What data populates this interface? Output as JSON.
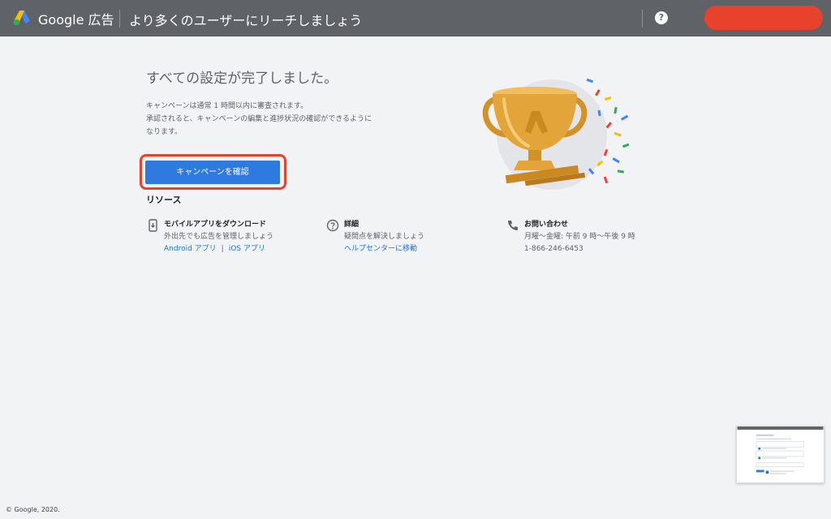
{
  "header": {
    "brand": "Google 広告",
    "page_heading": "より多くのユーザーにリーチしましょう",
    "help_glyph": "?",
    "account_color": "#e8412c"
  },
  "main": {
    "title": "すべての設定が完了しました。",
    "description_lines": [
      "キャンペーンは通常 1 時間以内に審査されます。",
      "承認されると、キャンペーンの編集と進捗状況の確認ができるように",
      "なります。"
    ],
    "primary_button": "キャンペーンを確認"
  },
  "resources": {
    "title": "リソース",
    "items": [
      {
        "icon": "mobile-download-icon",
        "title": "モバイルアプリをダウンロード",
        "subtitle": "外出先でも広告を管理しましょう",
        "link1": "Android アプリ",
        "separator": "|",
        "link2": "iOS アプリ"
      },
      {
        "icon": "help-circle-icon",
        "title": "詳細",
        "subtitle": "疑問点を解決しましょう",
        "link": "ヘルプセンターに移動"
      },
      {
        "icon": "phone-icon",
        "title": "お問い合わせ",
        "subtitle": "月曜〜金曜: 午前 9 時〜午後 9 時",
        "phone": "1-866-246-6453"
      }
    ]
  },
  "footer": {
    "copyright": "© Google, 2020."
  },
  "colors": {
    "topbar": "#5f6368",
    "primary": "#2f7ae0",
    "highlight": "#e8412c",
    "link": "#1a73e8",
    "trophy": "#e3a43a"
  }
}
